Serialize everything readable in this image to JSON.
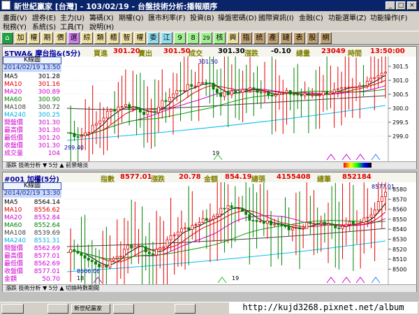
{
  "window": {
    "title": "新世紀贏家 [台灣] - 103/02/19 - 台盤技術分析:播報順序",
    "buttons": [
      "_",
      "□",
      "×"
    ]
  },
  "menu": {
    "row1": [
      "畫面(V)",
      "證券(E)",
      "主力(U)",
      "籌碼(X)",
      "期權(Q)",
      "匯市利率(F)",
      "投資(B)",
      "操盤密碼(D)",
      "國際資訊(I)",
      "金融(C)",
      "功能選單(Z)",
      "功能操作(F)"
    ],
    "row2": [
      "稅務(Y)",
      "系統(S)",
      "工具(T)",
      "說明(H)"
    ]
  },
  "toolbar": [
    "加",
    "權",
    "期",
    "價",
    "選",
    "綜",
    "類",
    "櫃",
    "智",
    "權",
    "委",
    "江",
    "9",
    "8",
    "29",
    "核",
    "興",
    "指",
    "統",
    "產",
    "鏈",
    "表",
    "股",
    "網"
  ],
  "top": {
    "symbol": "STWA& 摩台指&(5分)",
    "bid_label": "買進",
    "bid": "301.20",
    "ask_label": "賣出",
    "ask": "301.50",
    "last_label": "成交",
    "last": "301.30",
    "chg_label": "漲跌",
    "chg": "-0.10",
    "vol_label": "總量",
    "vol": "23049",
    "time_label": "時間",
    "time": "13:50:00",
    "box_title": "K線圖",
    "box_date": "2014/02/19 13:50",
    "rows": [
      {
        "k": "MA5",
        "v": "301.28",
        "c": "#000000"
      },
      {
        "k": "MA10",
        "v": "301.16",
        "c": "#e00000"
      },
      {
        "k": "MA20",
        "v": "300.89",
        "c": "#d000d0"
      },
      {
        "k": "MA60",
        "v": "300.90",
        "c": "#008000"
      },
      {
        "k": "MA108",
        "v": "300.72",
        "c": "#404040"
      },
      {
        "k": "MA240",
        "v": "300.25",
        "c": "#00b0e0"
      },
      {
        "k": "開盤價",
        "v": "301.30",
        "c": "#d000d0"
      },
      {
        "k": "最高價",
        "v": "301.30",
        "c": "#d000d0"
      },
      {
        "k": "最低價",
        "v": "301.20",
        "c": "#d000d0"
      },
      {
        "k": "收盤價",
        "v": "301.30",
        "c": "#d000d0"
      },
      {
        "k": "成交量",
        "v": "104",
        "c": "#d000d0"
      }
    ],
    "high_label": "301.50",
    "low_label": "299.40",
    "day_label": "19",
    "yaxis": [
      "301.5",
      "301.0",
      "300.5",
      "300.0",
      "299.5",
      "299.0"
    ],
    "status": "漲跌  技術分析 ▼  5分  ▲  前景暗淡"
  },
  "bottom": {
    "symbol": "#001 加權(5分)",
    "idx_label": "指數",
    "idx": "8577.01",
    "chg_label": "漲跌",
    "chg": "20.78",
    "amt_label": "金額",
    "amt": "854.19",
    "vol_label": "總張",
    "vol": "4155408",
    "cnt_label": "總筆",
    "cnt": "852184",
    "box_title": "K線圖",
    "box_date": "2014/02/19 13:30",
    "rows": [
      {
        "k": "MA5",
        "v": "8564.14",
        "c": "#000000"
      },
      {
        "k": "MA10",
        "v": "8556.62",
        "c": "#e00000"
      },
      {
        "k": "MA20",
        "v": "8552.84",
        "c": "#d000d0"
      },
      {
        "k": "MA60",
        "v": "8552.64",
        "c": "#008000"
      },
      {
        "k": "MA108",
        "v": "8539.69",
        "c": "#404040"
      },
      {
        "k": "MA240",
        "v": "8531.31",
        "c": "#00b0e0"
      },
      {
        "k": "開盤價",
        "v": "8562.69",
        "c": "#d000d0"
      },
      {
        "k": "最高價",
        "v": "8577.01",
        "c": "#d000d0"
      },
      {
        "k": "最低價",
        "v": "8562.69",
        "c": "#d000d0"
      },
      {
        "k": "收盤價",
        "v": "8577.01",
        "c": "#d000d0"
      },
      {
        "k": "金額",
        "v": "50.70",
        "c": "#d000d0"
      }
    ],
    "high_label": "8577.01",
    "low_label": "8506.06",
    "day_label1": "18",
    "day_label2": "19",
    "yaxis": [
      "8580",
      "8570",
      "8560",
      "8550",
      "8540",
      "8530",
      "8520",
      "8510",
      "8500"
    ],
    "status": "漲跌  技術分析 ▼  5分  ▲  切換時數期間"
  },
  "taskbar": {
    "items": [
      "",
      "",
      "新世紀贏家",
      "",
      ""
    ]
  },
  "watermark": "http://kujd3268.pixnet.net/album",
  "colors": {
    "up": "#e00000",
    "down": "#008000",
    "ma5": "#000000",
    "ma10": "#e00000",
    "ma20": "#d000d0",
    "ma60": "#00a000",
    "ma108": "#404040",
    "ma240": "#00c0f0"
  }
}
